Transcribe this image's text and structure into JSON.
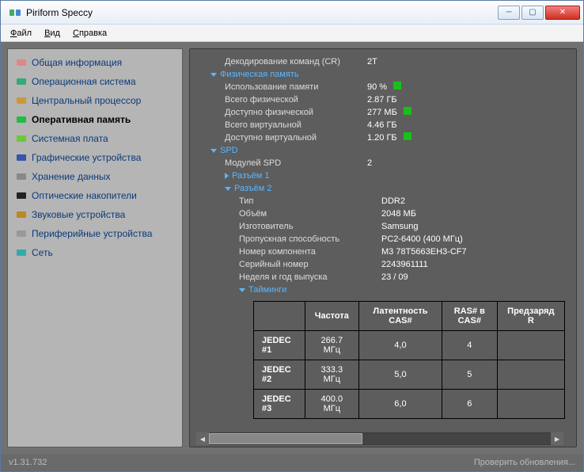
{
  "window": {
    "title": "Piriform Speccy"
  },
  "menu": {
    "file": "Файл",
    "view": "Вид",
    "help": "Справка"
  },
  "sidebar": {
    "items": [
      {
        "label": "Общая информация",
        "icon": "summary-icon"
      },
      {
        "label": "Операционная система",
        "icon": "os-icon"
      },
      {
        "label": "Центральный процессор",
        "icon": "cpu-icon"
      },
      {
        "label": "Оперативная память",
        "icon": "ram-icon",
        "selected": true
      },
      {
        "label": "Системная плата",
        "icon": "motherboard-icon"
      },
      {
        "label": "Графические устройства",
        "icon": "gpu-icon"
      },
      {
        "label": "Хранение данных",
        "icon": "storage-icon"
      },
      {
        "label": "Оптические накопители",
        "icon": "optical-icon"
      },
      {
        "label": "Звуковые устройства",
        "icon": "audio-icon"
      },
      {
        "label": "Периферийные устройства",
        "icon": "peripherals-icon"
      },
      {
        "label": "Сеть",
        "icon": "network-icon"
      }
    ]
  },
  "content": {
    "top": {
      "cr_label": "Декодирование команд (CR)",
      "cr_value": "2T"
    },
    "physmem": {
      "title": "Физическая память",
      "rows": [
        {
          "label": "Использование памяти",
          "value": "90 %",
          "indicator": true
        },
        {
          "label": "Всего физической",
          "value": "2.87 ГБ"
        },
        {
          "label": "Доступно физической",
          "value": "277 МБ",
          "indicator": true
        },
        {
          "label": "Всего виртуальной",
          "value": "4.46 ГБ"
        },
        {
          "label": "Доступно виртуальной",
          "value": "1.20 ГБ",
          "indicator": true
        }
      ]
    },
    "spd": {
      "title": "SPD",
      "modules_label": "Модулей SPD",
      "modules_value": "2",
      "slot1": "Разъём 1",
      "slot2": "Разъём 2",
      "slot2_rows": [
        {
          "label": "Тип",
          "value": "DDR2"
        },
        {
          "label": "Объём",
          "value": "2048 МБ"
        },
        {
          "label": "Изготовитель",
          "value": "Samsung"
        },
        {
          "label": "Пропускная способность",
          "value": "PC2-6400 (400 МГц)"
        },
        {
          "label": "Номер компонента",
          "value": "M3 78T5663EH3-CF7"
        },
        {
          "label": "Серийный номер",
          "value": "2243961111"
        },
        {
          "label": "Неделя и год выпуска",
          "value": "23 / 09"
        }
      ],
      "timings": "Тайминги"
    },
    "table": {
      "headers": [
        "Частота",
        "Латентность CAS#",
        "RAS# в CAS#",
        "Предзаряд R"
      ],
      "rows": [
        {
          "name": "JEDEC #1",
          "cells": [
            "266.7 МГц",
            "4,0",
            "4",
            ""
          ]
        },
        {
          "name": "JEDEC #2",
          "cells": [
            "333.3 МГц",
            "5,0",
            "5",
            ""
          ]
        },
        {
          "name": "JEDEC #3",
          "cells": [
            "400.0 МГц",
            "6,0",
            "6",
            ""
          ]
        }
      ]
    }
  },
  "statusbar": {
    "version": "v1.31.732",
    "update": "Проверить обновления..."
  }
}
